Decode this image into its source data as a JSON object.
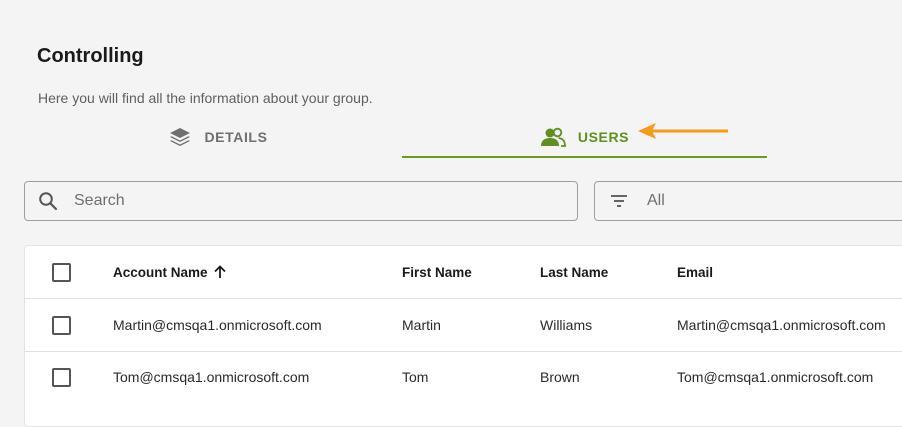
{
  "page": {
    "title": "Controlling",
    "subtitle": "Here you will find all the information about your group."
  },
  "tabs": [
    {
      "label": "DETAILS",
      "icon": "layers-icon",
      "active": false
    },
    {
      "label": "USERS",
      "icon": "users-icon",
      "active": true
    }
  ],
  "search": {
    "placeholder": "Search",
    "value": ""
  },
  "filter": {
    "value": "All",
    "icon": "filter-lines-icon"
  },
  "table": {
    "columns": [
      "Account Name",
      "First Name",
      "Last Name",
      "Email"
    ],
    "sort": {
      "column": "Account Name",
      "direction": "ascending"
    },
    "rows": [
      {
        "account": "Martin@cmsqa1.onmicrosoft.com",
        "first": "Martin",
        "last": "Williams",
        "email": "Martin@cmsqa1.onmicrosoft.com"
      },
      {
        "account": "Tom@cmsqa1.onmicrosoft.com",
        "first": "Tom",
        "last": "Brown",
        "email": "Tom@cmsqa1.onmicrosoft.com"
      }
    ]
  },
  "colors": {
    "accent": "#5e8f1f",
    "annotation_arrow": "#f59a1b",
    "background": "#f4f4f4"
  }
}
